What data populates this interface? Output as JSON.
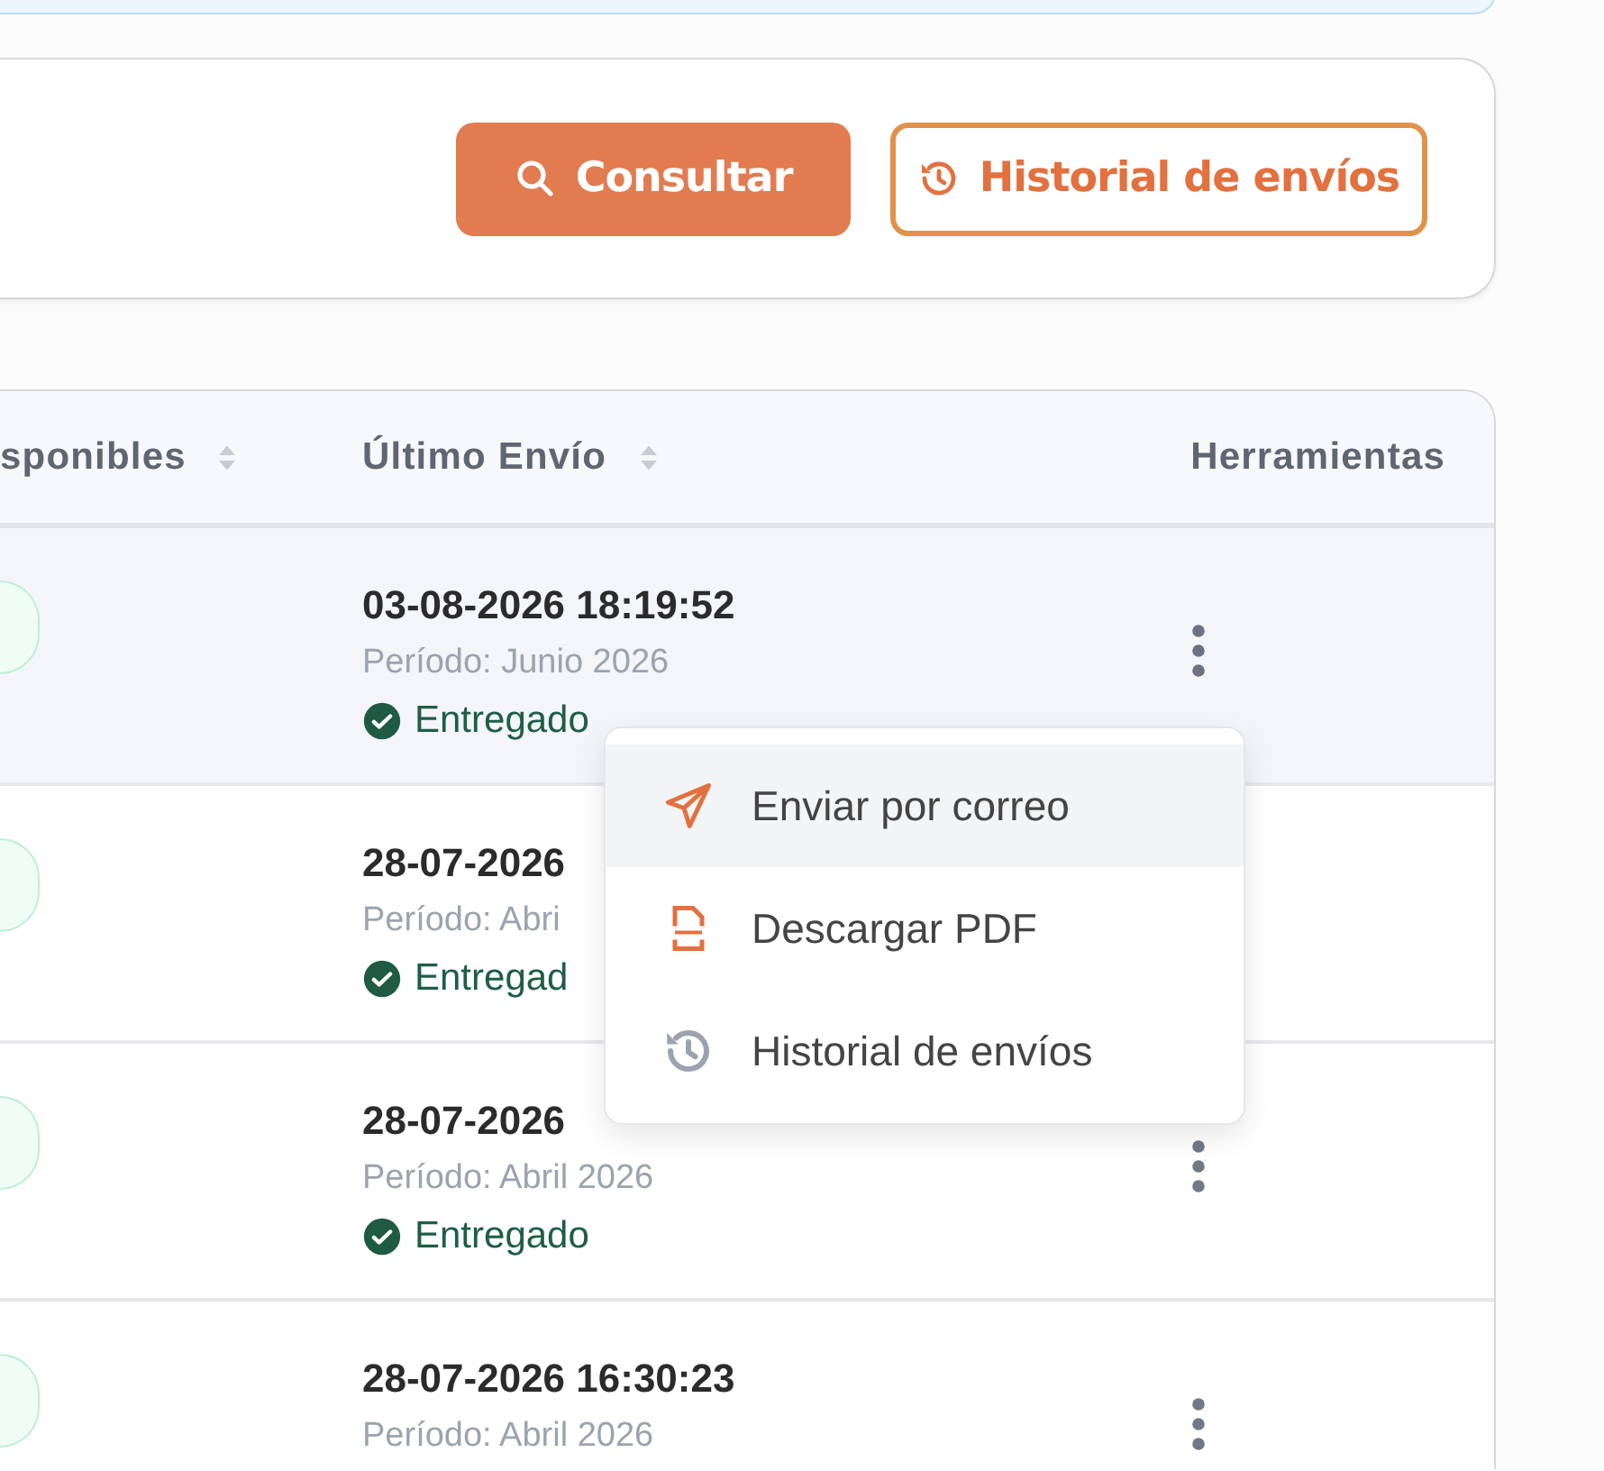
{
  "filter_card": {
    "buttons": [
      {
        "label": "Consultar",
        "kind": "primary"
      },
      {
        "label": "Historial de envíos",
        "kind": "outline"
      }
    ]
  },
  "table": {
    "columns": [
      {
        "label": "sponibles",
        "sortable": true
      },
      {
        "label": "Último Envío",
        "sortable": true
      },
      {
        "label": "Herramientas",
        "sortable": false
      }
    ],
    "rows": [
      {
        "highlighted": true,
        "last_sent": "03-08-2026 18:19:52",
        "period": "Período: Junio 2026",
        "status": "Entregado",
        "menu_open": true
      },
      {
        "highlighted": false,
        "last_sent": "28-07-2026",
        "period": "Período: Abri",
        "status": "Entregad",
        "menu_open": false
      },
      {
        "highlighted": false,
        "last_sent": "28-07-2026",
        "period": "Período: Abril 2026",
        "status": "Entregado",
        "menu_open": false
      },
      {
        "highlighted": false,
        "last_sent": "28-07-2026 16:30:23",
        "period": "Período: Abril 2026",
        "menu_open": false
      }
    ],
    "row_menu": {
      "items": [
        {
          "label": "Enviar por correo",
          "kind": "email",
          "highlighted": true
        },
        {
          "label": "Descargar PDF",
          "kind": "pdf",
          "highlighted": false
        },
        {
          "label": "Historial de envíos",
          "kind": "history",
          "highlighted": false
        }
      ]
    }
  }
}
